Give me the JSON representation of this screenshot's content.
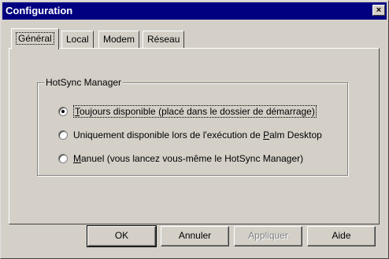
{
  "window": {
    "title": "Configuration",
    "close_label": "×"
  },
  "tabs": [
    {
      "label": "Général",
      "active": true
    },
    {
      "label": "Local",
      "active": false
    },
    {
      "label": "Modem",
      "active": false
    },
    {
      "label": "Réseau",
      "active": false
    }
  ],
  "group": {
    "title": "HotSync Manager",
    "options": [
      {
        "accel": "T",
        "rest": "oujours disponible (placé dans le dossier de démarrage)",
        "selected": true
      },
      {
        "pre": "Uniquement disponible lors de l'exécution de ",
        "accel": "P",
        "rest": "alm Desktop",
        "selected": false
      },
      {
        "accel": "M",
        "rest": "anuel (vous lancez vous-même le HotSync Manager)",
        "selected": false
      }
    ]
  },
  "buttons": {
    "ok": "OK",
    "cancel": "Annuler",
    "apply": "Appliquer",
    "help": "Aide"
  },
  "colors": {
    "titlebar": "#000080",
    "face": "#d4d0c8"
  }
}
